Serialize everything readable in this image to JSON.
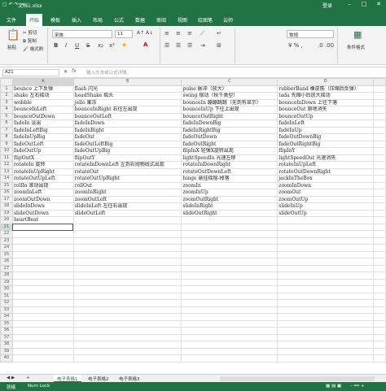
{
  "window": {
    "filename": "文档1.xlsx",
    "login": "登录",
    "qat": "▢ ↶ ↷ ="
  },
  "menu": [
    "文件",
    "开始",
    "模板",
    "插入",
    "布局",
    "公式",
    "数据",
    "审阅",
    "视图",
    "绘图笔",
    "云师"
  ],
  "ribbon": {
    "paste": "粘贴",
    "cut": "剪切",
    "copy": "复制",
    "format_painter": "格式刷",
    "font_name": "宋体",
    "font_size": "11",
    "number_format": "常规",
    "table_style": "条件格式"
  },
  "formula_bar": {
    "namebox": "A21",
    "fx": "fx",
    "placeholder": "输入文本或公式详情。"
  },
  "columns": [
    "A",
    "B",
    "C",
    "D"
  ],
  "rows": [
    [
      "bounce 上下反弹",
      "flash 闪光",
      "pulse 脉冲（放大）",
      "rubberBand 橡皮筋（压缩后反弹）"
    ],
    [
      "shake 左右摇动",
      "headShake 摇头",
      "swing 摆动（秋千类型）",
      "tada 先缩小后放大摇动"
    ],
    [
      "wobble",
      "jello 果冻",
      "bounceIn 蹦蹦跳跳（无到有显示）",
      "bounceInDown 上往下落"
    ],
    [
      "bounceInLeft",
      "bounceInRight 右往左出现",
      "bounceInUp 下往上出现",
      "bounceOut 原地消失"
    ],
    [
      "bounceOutDown",
      "bounceOutLeft",
      "bounceOutRight",
      "bounceOutUp"
    ],
    [
      "fadeIn 淡出",
      "fadeInDown",
      "fadeInDownBig",
      "fadeInLeft"
    ],
    [
      "fadeInLeftBig",
      "fadeInRight",
      "fadeInRightBig",
      "fadeInUp"
    ],
    [
      "fadeInUpBig",
      "fadeOut",
      "fadeOutDown",
      "fadeOutDownBig"
    ],
    [
      "fadeOutLeft",
      "fadeOutLeftBig",
      "fadeOutRight",
      "fadeOutRightBig"
    ],
    [
      "fadeOutUp",
      "fadeOutUpBig",
      "flipInX 轻弹X旋转出现",
      "flipInY"
    ],
    [
      "flipOutX",
      "flipOutY",
      "lightSpeedIn 光速左移",
      "lightSpeedOut 光速消失"
    ],
    [
      "rotateIn 旋转",
      "rotateInDownLeft 左到右抛物线式出现",
      "rotateInDownRight",
      "rotateInUpLeft"
    ],
    [
      "rotateInUpRight",
      "rotateOut",
      "rotateOutDownLeft",
      "rotateOutDownRight"
    ],
    [
      "rotateOutUpLeft",
      "rotateOutUpRight",
      "hinge 悬挂摇摆-掉落",
      "jackInTheBox"
    ],
    [
      "rollIn 滚动出现",
      "rollOut",
      "zoomIn",
      "zoomInDown"
    ],
    [
      "zoomInLeft",
      "zoomInRight",
      "zoomInUp",
      "zoomOut"
    ],
    [
      "zoomOutDown",
      "zoomOutLeft",
      "zoomOutRight",
      "zoomOutUp"
    ],
    [
      "slideInDown",
      "slideInLeft 左往右出现",
      "slideInRight",
      "slideInUp"
    ],
    [
      "slideOutDown",
      "slideOutLeft",
      "slideOutRight",
      "slideOutUp"
    ],
    [
      "heartBeat",
      "",
      "",
      ""
    ]
  ],
  "sheets": [
    "电子表格1",
    "电子表格2",
    "电子表格3"
  ],
  "status": {
    "ready": "就绪",
    "numlock": "Num Lock"
  },
  "colors": {
    "brand": "#217346"
  }
}
